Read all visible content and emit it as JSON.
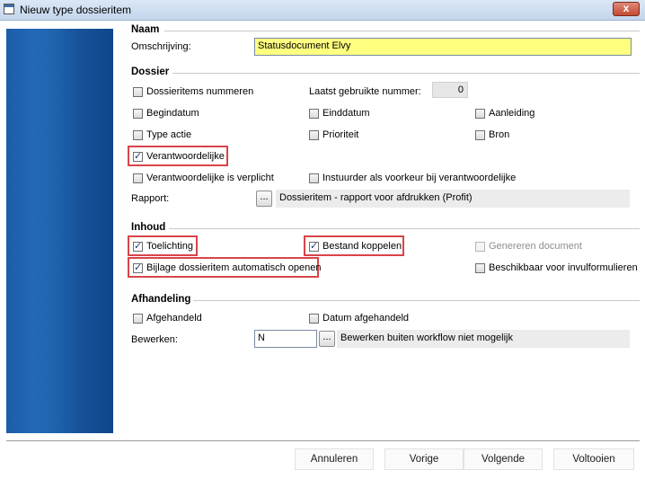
{
  "window": {
    "title": "Nieuw type dossieritem",
    "close_label": "x"
  },
  "naam": {
    "header": "Naam",
    "omschrijving_label": "Omschrijving:",
    "omschrijving_value": "Statusdocument Elvy"
  },
  "dossier": {
    "header": "Dossier",
    "nummeren": "Dossieritems nummeren",
    "laatst_label": "Laatst gebruikte nummer:",
    "laatst_value": "0",
    "begindatum": "Begindatum",
    "einddatum": "Einddatum",
    "aanleiding": "Aanleiding",
    "type_actie": "Type actie",
    "prioriteit": "Prioriteit",
    "bron": "Bron",
    "verantwoordelijke": "Verantwoordelijke",
    "verplicht": "Verantwoordelijke is verplicht",
    "instuurder": "Instuurder als voorkeur bij verantwoordelijke",
    "rapport_label": "Rapport:",
    "rapport_button": "...",
    "rapport_value": "Dossieritem - rapport voor afdrukken (Profit)"
  },
  "inhoud": {
    "header": "Inhoud",
    "toelichting": "Toelichting",
    "bestand": "Bestand koppelen",
    "genereren": "Genereren document",
    "bijlage": "Bijlage dossieritem automatisch openen",
    "beschikbaar": "Beschikbaar voor invulformulieren"
  },
  "afhandeling": {
    "header": "Afhandeling",
    "afgehandeld": "Afgehandeld",
    "datum_afgehandeld": "Datum afgehandeld",
    "bewerken_label": "Bewerken:",
    "bewerken_value": "N",
    "bewerken_button": "...",
    "bewerken_desc": "Bewerken buiten workflow niet mogelijk"
  },
  "buttons": {
    "annuleren": "Annuleren",
    "vorige": "Vorige",
    "volgende": "Volgende",
    "voltooien": "Voltooien"
  },
  "colors": {
    "sidebar": "#1b5ca8",
    "highlight": "#d9444b",
    "required_field": "#ffff80"
  }
}
